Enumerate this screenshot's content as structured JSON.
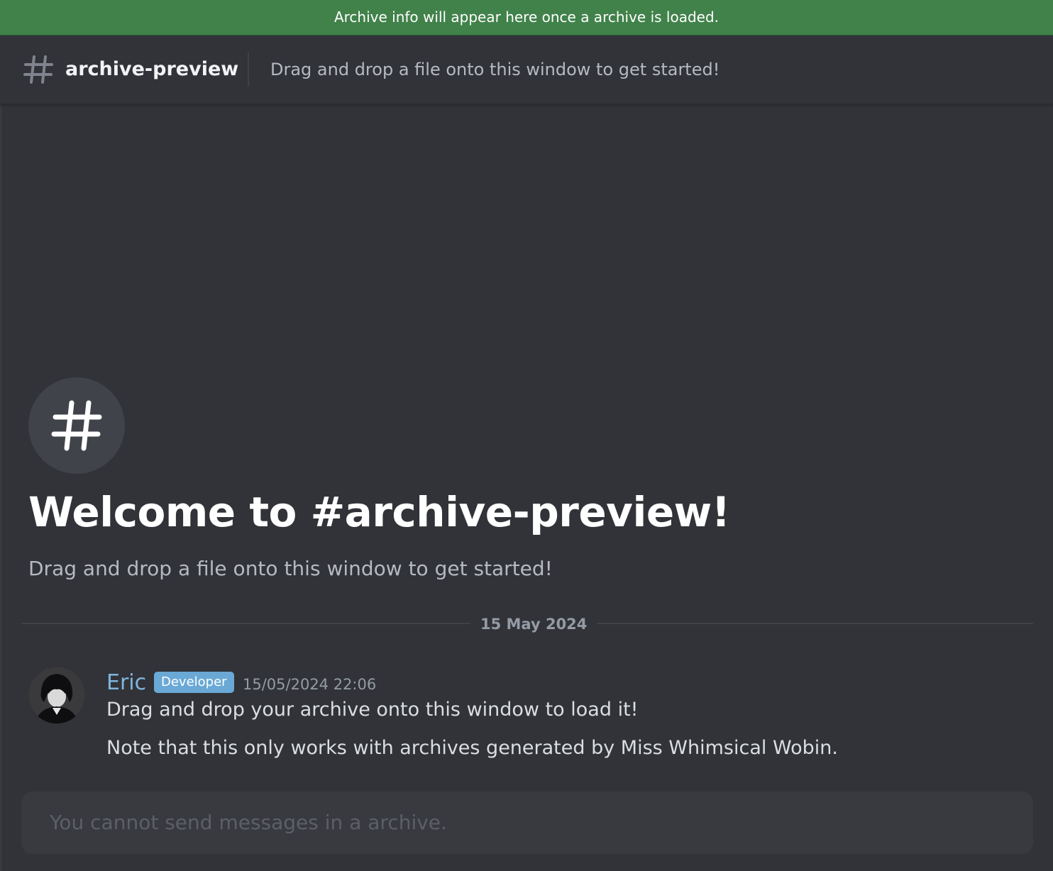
{
  "banner": {
    "text": "Archive info will appear here once a archive is loaded."
  },
  "header": {
    "icon": "hash-icon",
    "channel_name": "archive-preview",
    "topic": "Drag and drop a file onto this window to get started!"
  },
  "welcome": {
    "icon": "hash-icon",
    "title": "Welcome to #archive-preview!",
    "subtitle": "Drag and drop a file onto this window to get started!"
  },
  "divider": {
    "date": "15 May 2024"
  },
  "message": {
    "author": "Eric",
    "author_color": "#7fb6de",
    "badge": "Developer",
    "badge_color": "#6aa9d6",
    "timestamp": "15/05/2024 22:06",
    "lines": [
      "Drag and drop your archive onto this window to load it!",
      "Note that this only works with archives generated by Miss Whimsical Wobin."
    ]
  },
  "composer": {
    "placeholder": "You cannot send messages in a archive."
  },
  "colors": {
    "background": "#313338",
    "banner": "#41824a",
    "composer": "#383a40"
  }
}
